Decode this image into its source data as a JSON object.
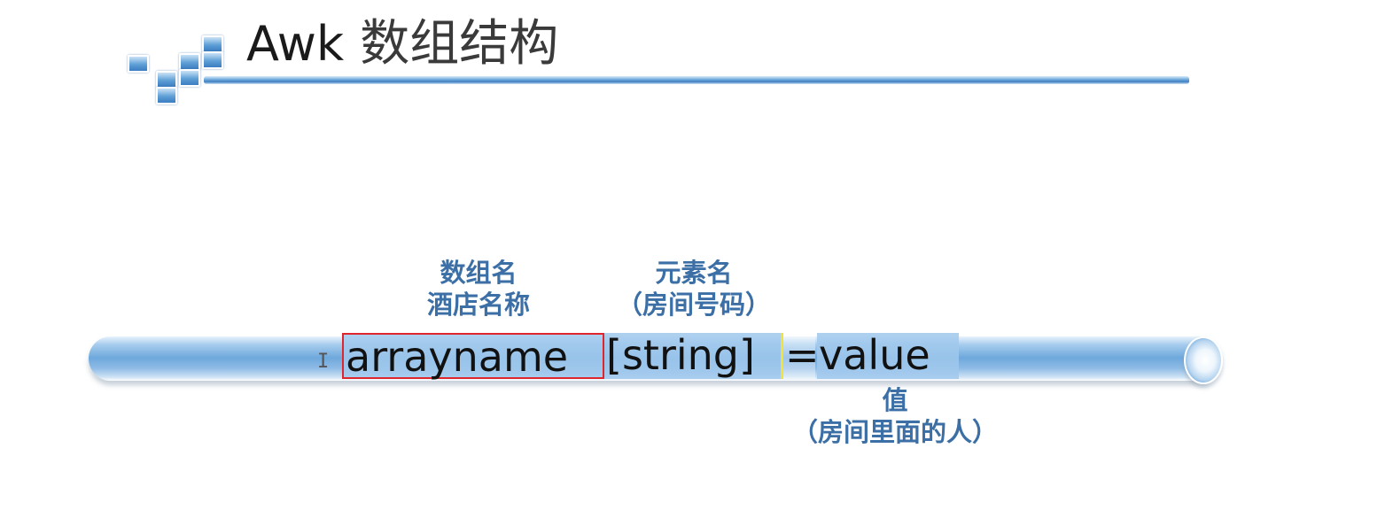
{
  "title": {
    "main": "Awk",
    "cn": "数组结构"
  },
  "diagram": {
    "syntax": {
      "arrayname": "arrayname",
      "string": "[string]",
      "equals": "=",
      "value": "value"
    },
    "annotations": {
      "array_name": {
        "line1": "数组名",
        "line2": "酒店名称"
      },
      "element_name": {
        "line1": "元素名",
        "line2": "（房间号码）"
      },
      "value": {
        "line1": "值",
        "line2": "（房间里面的人）"
      }
    },
    "colors": {
      "arrayname_border": "#e0262d",
      "string_border": "#f2e23a",
      "annotation_text": "#3b6fa5",
      "pipe": "#6ea8dc"
    }
  }
}
